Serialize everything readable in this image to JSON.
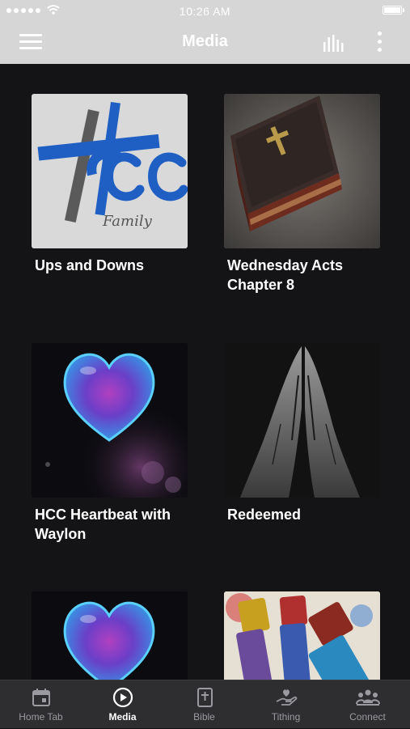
{
  "status": {
    "time": "10:26 AM"
  },
  "header": {
    "title": "Media"
  },
  "cards": [
    {
      "title": "Ups and Downs",
      "art_icon": "hcc-family-logo",
      "logo_text": "Family"
    },
    {
      "title": "Wednesday Acts Chapter 8",
      "art_icon": "bible-book-image"
    },
    {
      "title": "HCC Heartbeat with Waylon",
      "art_icon": "glass-heart-image"
    },
    {
      "title": "Redeemed",
      "art_icon": "praying-hands-image"
    },
    {
      "title": "",
      "art_icon": "glass-heart-image"
    },
    {
      "title": "",
      "art_icon": "paint-brushes-image"
    }
  ],
  "tabs": [
    {
      "label": "Home Tab",
      "icon": "calendar-icon",
      "active": false
    },
    {
      "label": "Media",
      "icon": "play-circle-icon",
      "active": true
    },
    {
      "label": "Bible",
      "icon": "bible-icon",
      "active": false
    },
    {
      "label": "Tithing",
      "icon": "hand-heart-icon",
      "active": false
    },
    {
      "label": "Connect",
      "icon": "group-icon",
      "active": false
    }
  ],
  "colors": {
    "header_bg": "#d6d6d6",
    "content_bg": "#141416",
    "tabbar_bg": "#2e2e30",
    "logo_blue": "#1f5fc4"
  }
}
